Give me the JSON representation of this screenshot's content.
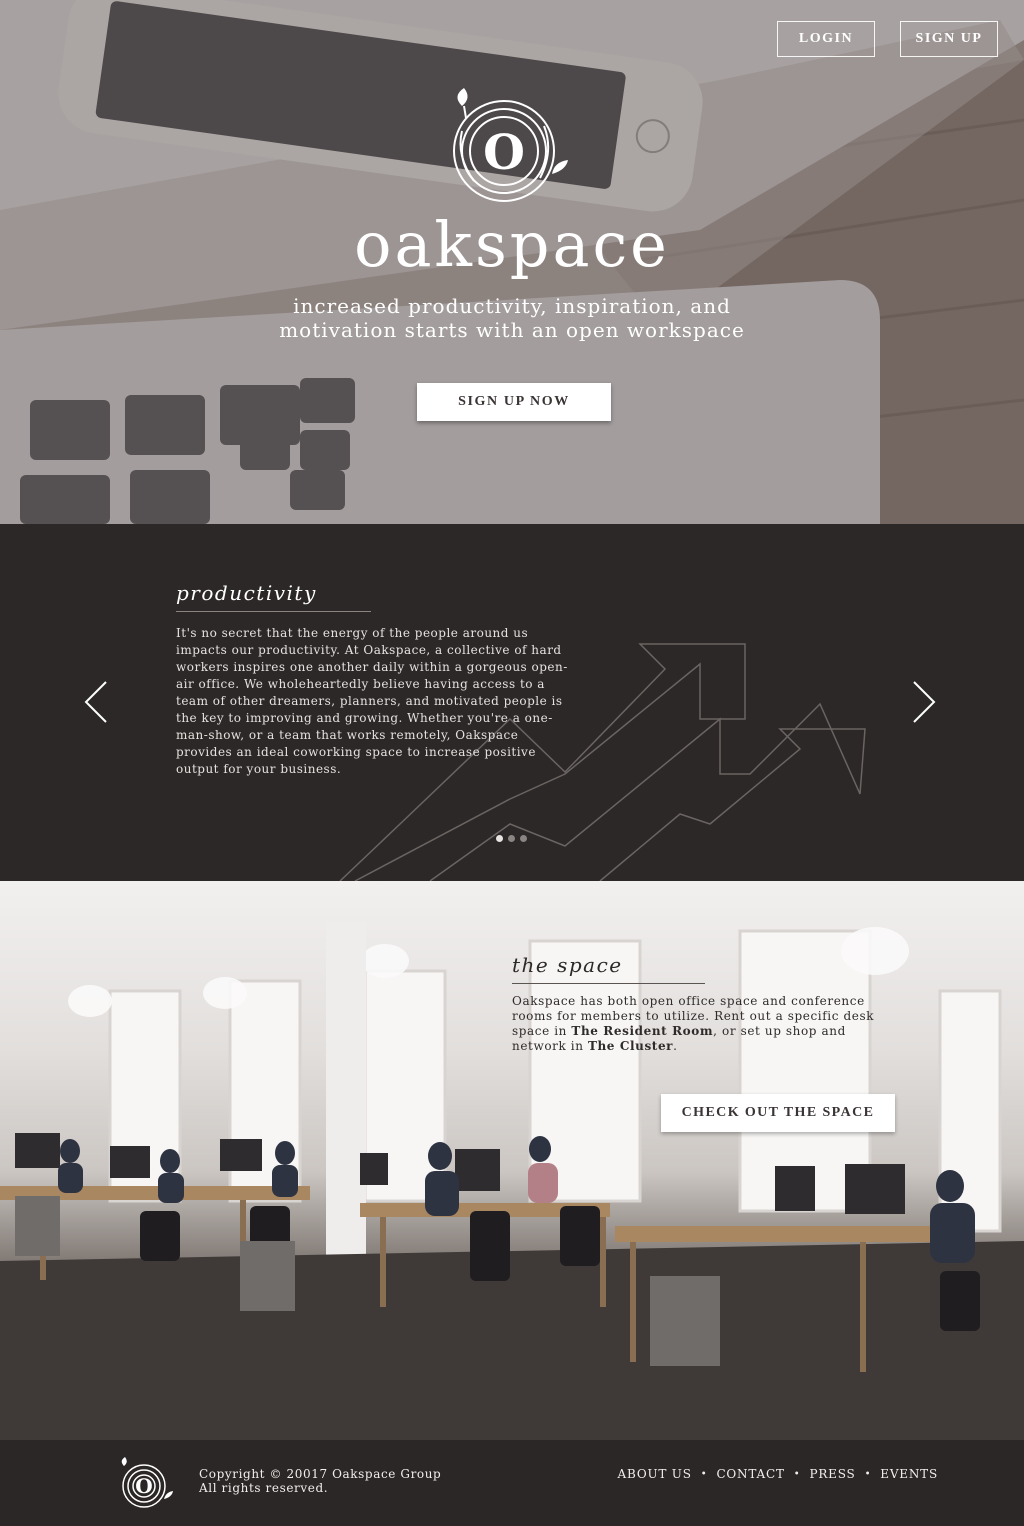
{
  "header": {
    "login_label": "LOGIN",
    "signup_label": "SIGN UP"
  },
  "hero": {
    "brand": "oakspace",
    "tagline_line1": "increased productivity, inspiration, and",
    "tagline_line2": "motivation starts with an open workspace",
    "cta_label": "SIGN UP NOW"
  },
  "productivity": {
    "title": "productivity",
    "body": "It's no secret that the energy of the people around us impacts our productivity.  At Oakspace, a collective of hard workers inspires one another daily within a gorgeous open-air office.  We wholeheartedly believe having access to a team of other dreamers, planners, and motivated people is the key to improving and growing.  Whether you're a one-man-show, or a team that works remotely, Oakspace provides an ideal coworking space to increase positive output for your business.",
    "active_slide": 1,
    "slide_count": 3
  },
  "space": {
    "title": "the space",
    "body_part1": "Oakspace has both open office space and conference rooms for members to utilize.  Rent out a specific desk space in ",
    "resident_room": "The Resident Room",
    "body_part2": ", or set up shop and network in ",
    "cluster": "The Cluster",
    "body_part3": ".",
    "cta_label": "CHECK OUT THE SPACE"
  },
  "footer": {
    "copyright_line1": "Copyright © 20017 Oakspace Group",
    "copyright_line2": "All rights reserved.",
    "nav": [
      "ABOUT US",
      "CONTACT",
      "PRESS",
      "EVENTS"
    ],
    "separator": "•"
  },
  "colors": {
    "dark_bg": "#2b2726",
    "button_text": "#3a3434",
    "white": "#ffffff"
  },
  "icons": [
    "oak-ring-logo-icon",
    "chevron-left-icon",
    "chevron-right-icon",
    "rising-arrows-icon"
  ]
}
